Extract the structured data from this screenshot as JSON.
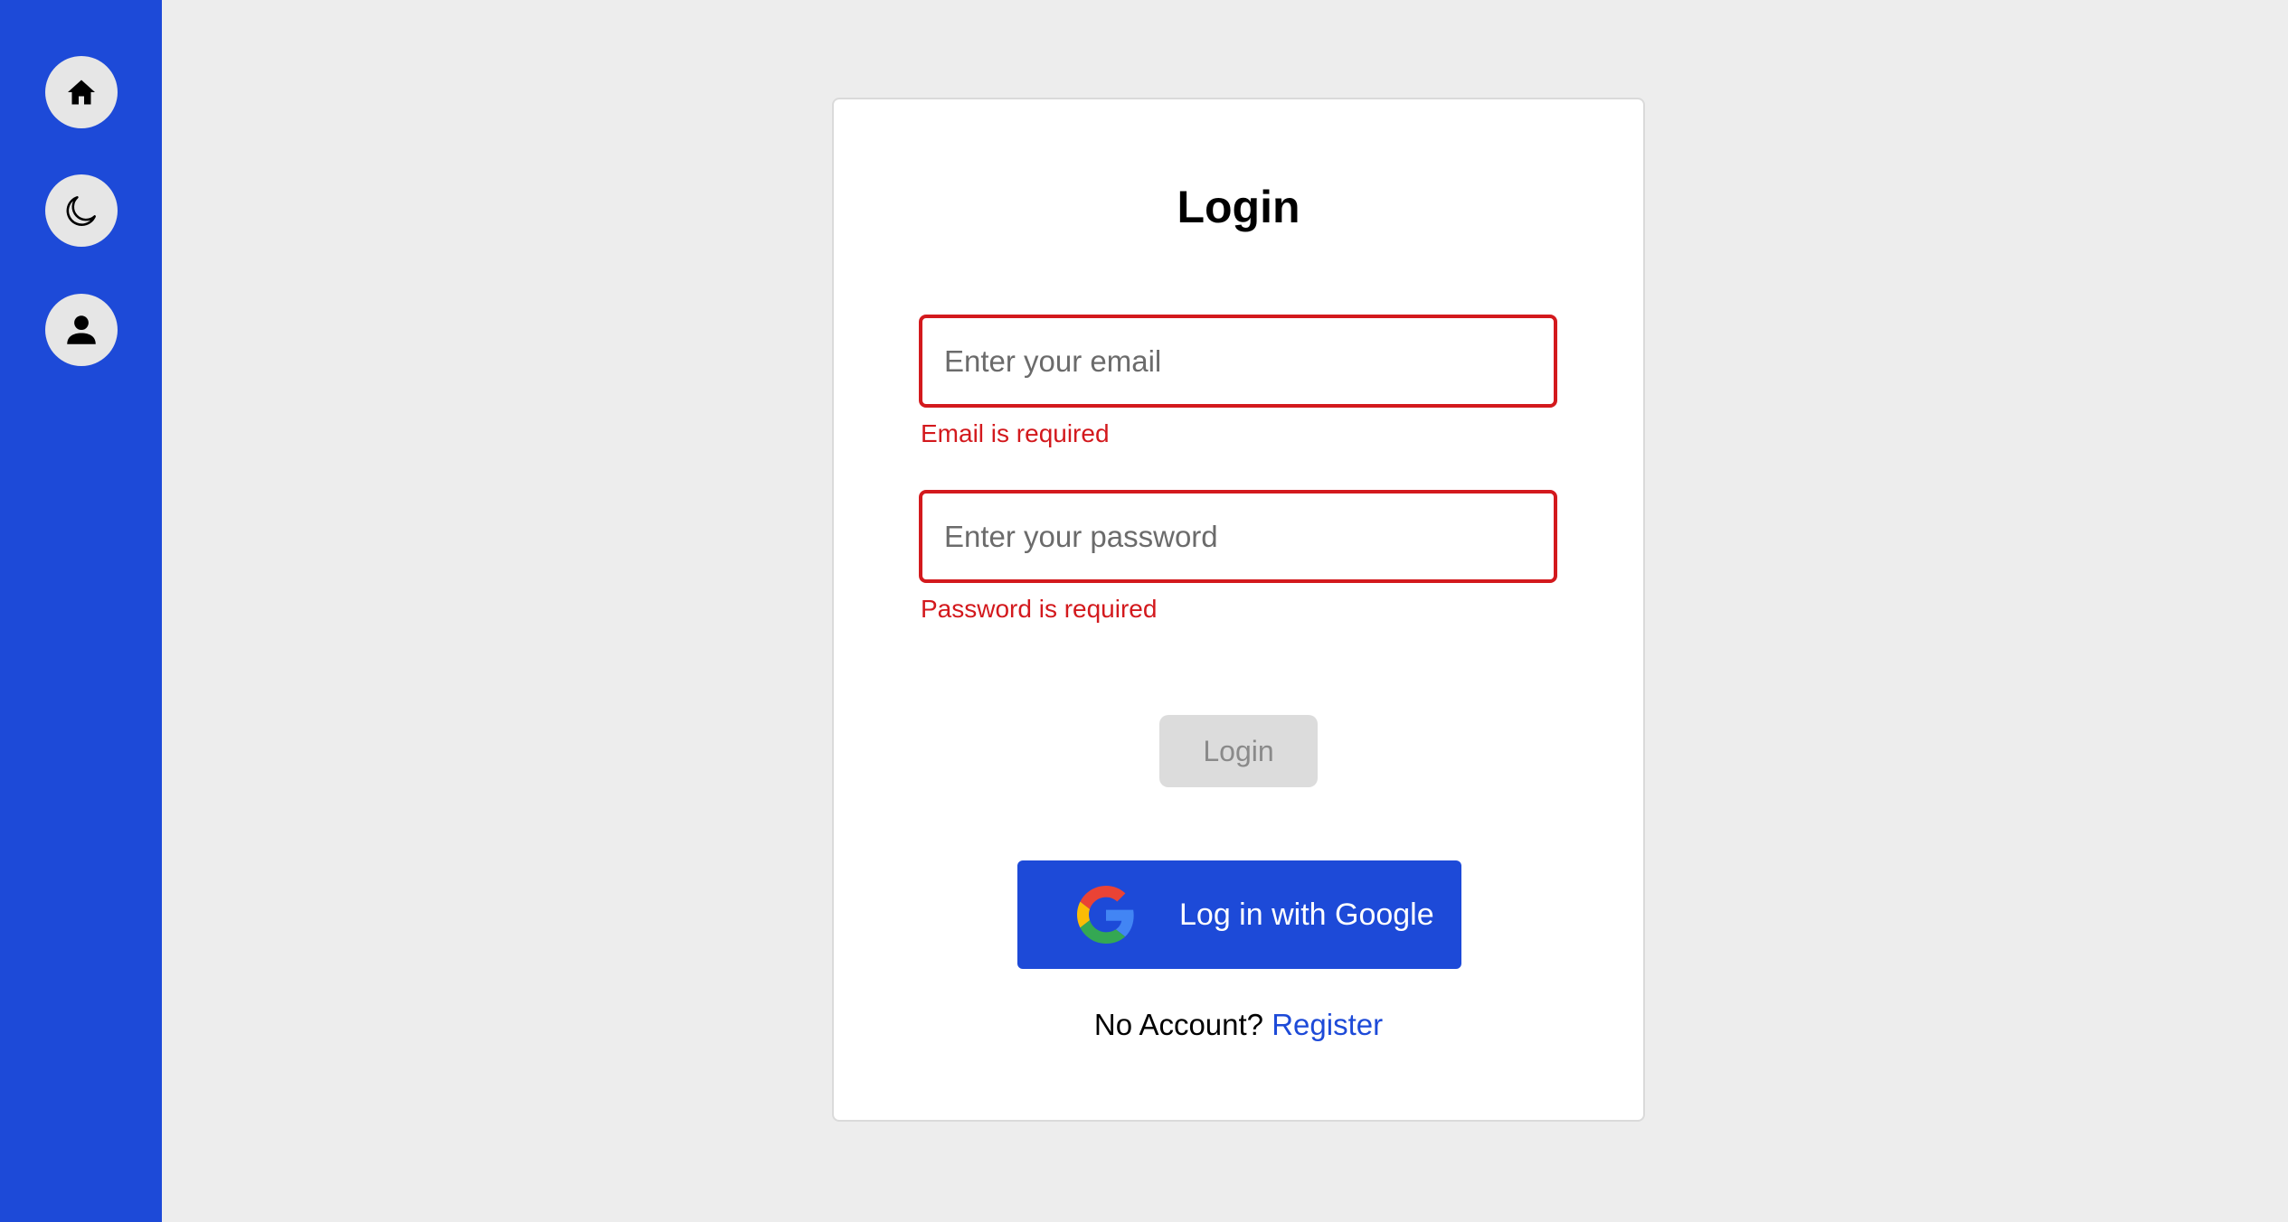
{
  "sidebar": {
    "items": [
      {
        "name": "home",
        "icon": "home-icon"
      },
      {
        "name": "theme",
        "icon": "moon-icon"
      },
      {
        "name": "profile",
        "icon": "user-icon"
      }
    ]
  },
  "login": {
    "title": "Login",
    "email": {
      "value": "",
      "placeholder": "Enter your email",
      "error": "Email is required"
    },
    "password": {
      "value": "",
      "placeholder": "Enter your password",
      "error": "Password is required"
    },
    "submit_label": "Login",
    "submit_disabled": true,
    "google_label": "Log in with Google",
    "google_icon": "google-icon",
    "footer_text": "No Account?",
    "register_link": "Register"
  },
  "colors": {
    "sidebar_bg": "#1d4ad8",
    "page_bg": "#ededed",
    "error": "#d3191d",
    "accent": "#1d4ad8",
    "disabled_bg": "#dcdcdc"
  }
}
